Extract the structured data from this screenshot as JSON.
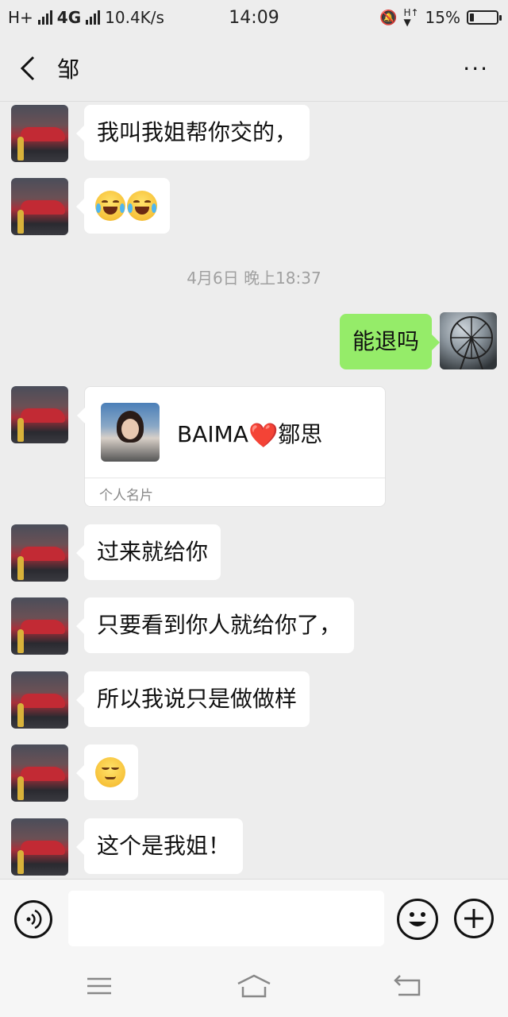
{
  "status_bar": {
    "network_left": "H+",
    "network_4g": "4G",
    "speed": "10.4K/s",
    "time": "14:09",
    "battery_percent_text": "15%",
    "battery_level": 0.15
  },
  "header": {
    "title": "邹",
    "more_label": "···"
  },
  "messages": [
    {
      "type": "text",
      "direction": "in",
      "text": "我叫我姐帮你交的，"
    },
    {
      "type": "emoji",
      "direction": "in",
      "emoji": [
        "joy-tears-emoji",
        "joy-tears-emoji"
      ]
    },
    {
      "type": "timestamp",
      "text": "4月6日 晚上18:37"
    },
    {
      "type": "text",
      "direction": "out",
      "text": "能退吗"
    },
    {
      "type": "contact_card",
      "direction": "in",
      "name_prefix": "BAIMA",
      "name_suffix": "鄒思",
      "heart": "❤️",
      "label": "个人名片"
    },
    {
      "type": "text",
      "direction": "in",
      "text": "过来就给你"
    },
    {
      "type": "text",
      "direction": "in",
      "text": "只要看到你人就给你了，"
    },
    {
      "type": "text",
      "direction": "in",
      "text": "所以我说只是做做样"
    },
    {
      "type": "emoji",
      "direction": "in",
      "emoji": [
        "smirk-emoji"
      ]
    },
    {
      "type": "text",
      "direction": "in",
      "text": "这个是我姐！"
    }
  ],
  "input_bar": {
    "voice_icon": "voice-icon",
    "emoji_icon": "emoji-icon",
    "plus_icon": "plus-icon",
    "message_value": ""
  },
  "system_nav": {
    "menu_icon": "menu-icon",
    "home_icon": "home-icon",
    "back_icon": "back-icon"
  }
}
